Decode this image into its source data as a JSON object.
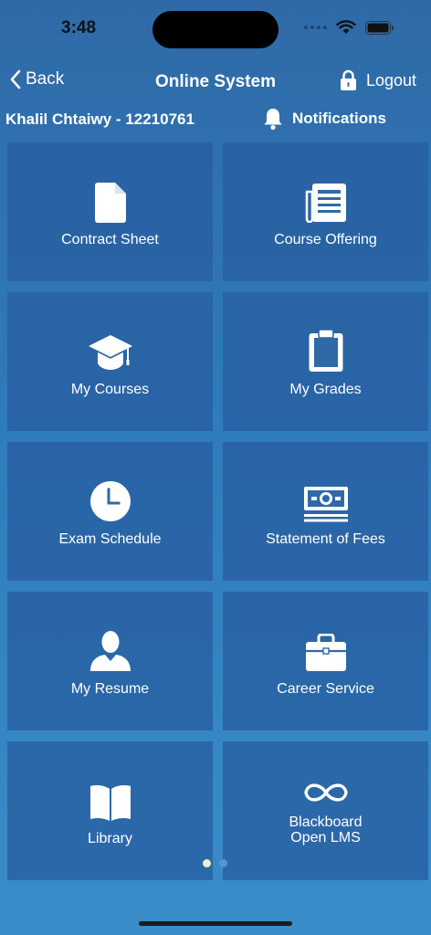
{
  "status": {
    "time": "3:48"
  },
  "nav": {
    "back_label": "Back",
    "title": "Online System",
    "logout_label": "Logout"
  },
  "user": {
    "name": "Khalil Chtaiwy - 12210761",
    "notifications_label": "Notifications"
  },
  "tiles": [
    {
      "label": "Contract Sheet",
      "icon": "document-icon"
    },
    {
      "label": "Course Offering",
      "icon": "newspaper-icon"
    },
    {
      "label": "My Courses",
      "icon": "graduation-cap-icon"
    },
    {
      "label": "My Grades",
      "icon": "clipboard-icon"
    },
    {
      "label": "Exam Schedule",
      "icon": "clock-icon"
    },
    {
      "label": "Statement of Fees",
      "icon": "money-icon"
    },
    {
      "label": "My Resume",
      "icon": "person-icon"
    },
    {
      "label": "Career Service",
      "icon": "briefcase-icon"
    },
    {
      "label": "Library",
      "icon": "book-icon"
    },
    {
      "label": "Blackboard\nOpen LMS",
      "icon": "infinity-icon"
    }
  ],
  "pager": {
    "pages": 2,
    "current": 1
  },
  "colors": {
    "active_dot": "#f3f0c2",
    "inactive_dot": "#5b93c8"
  }
}
